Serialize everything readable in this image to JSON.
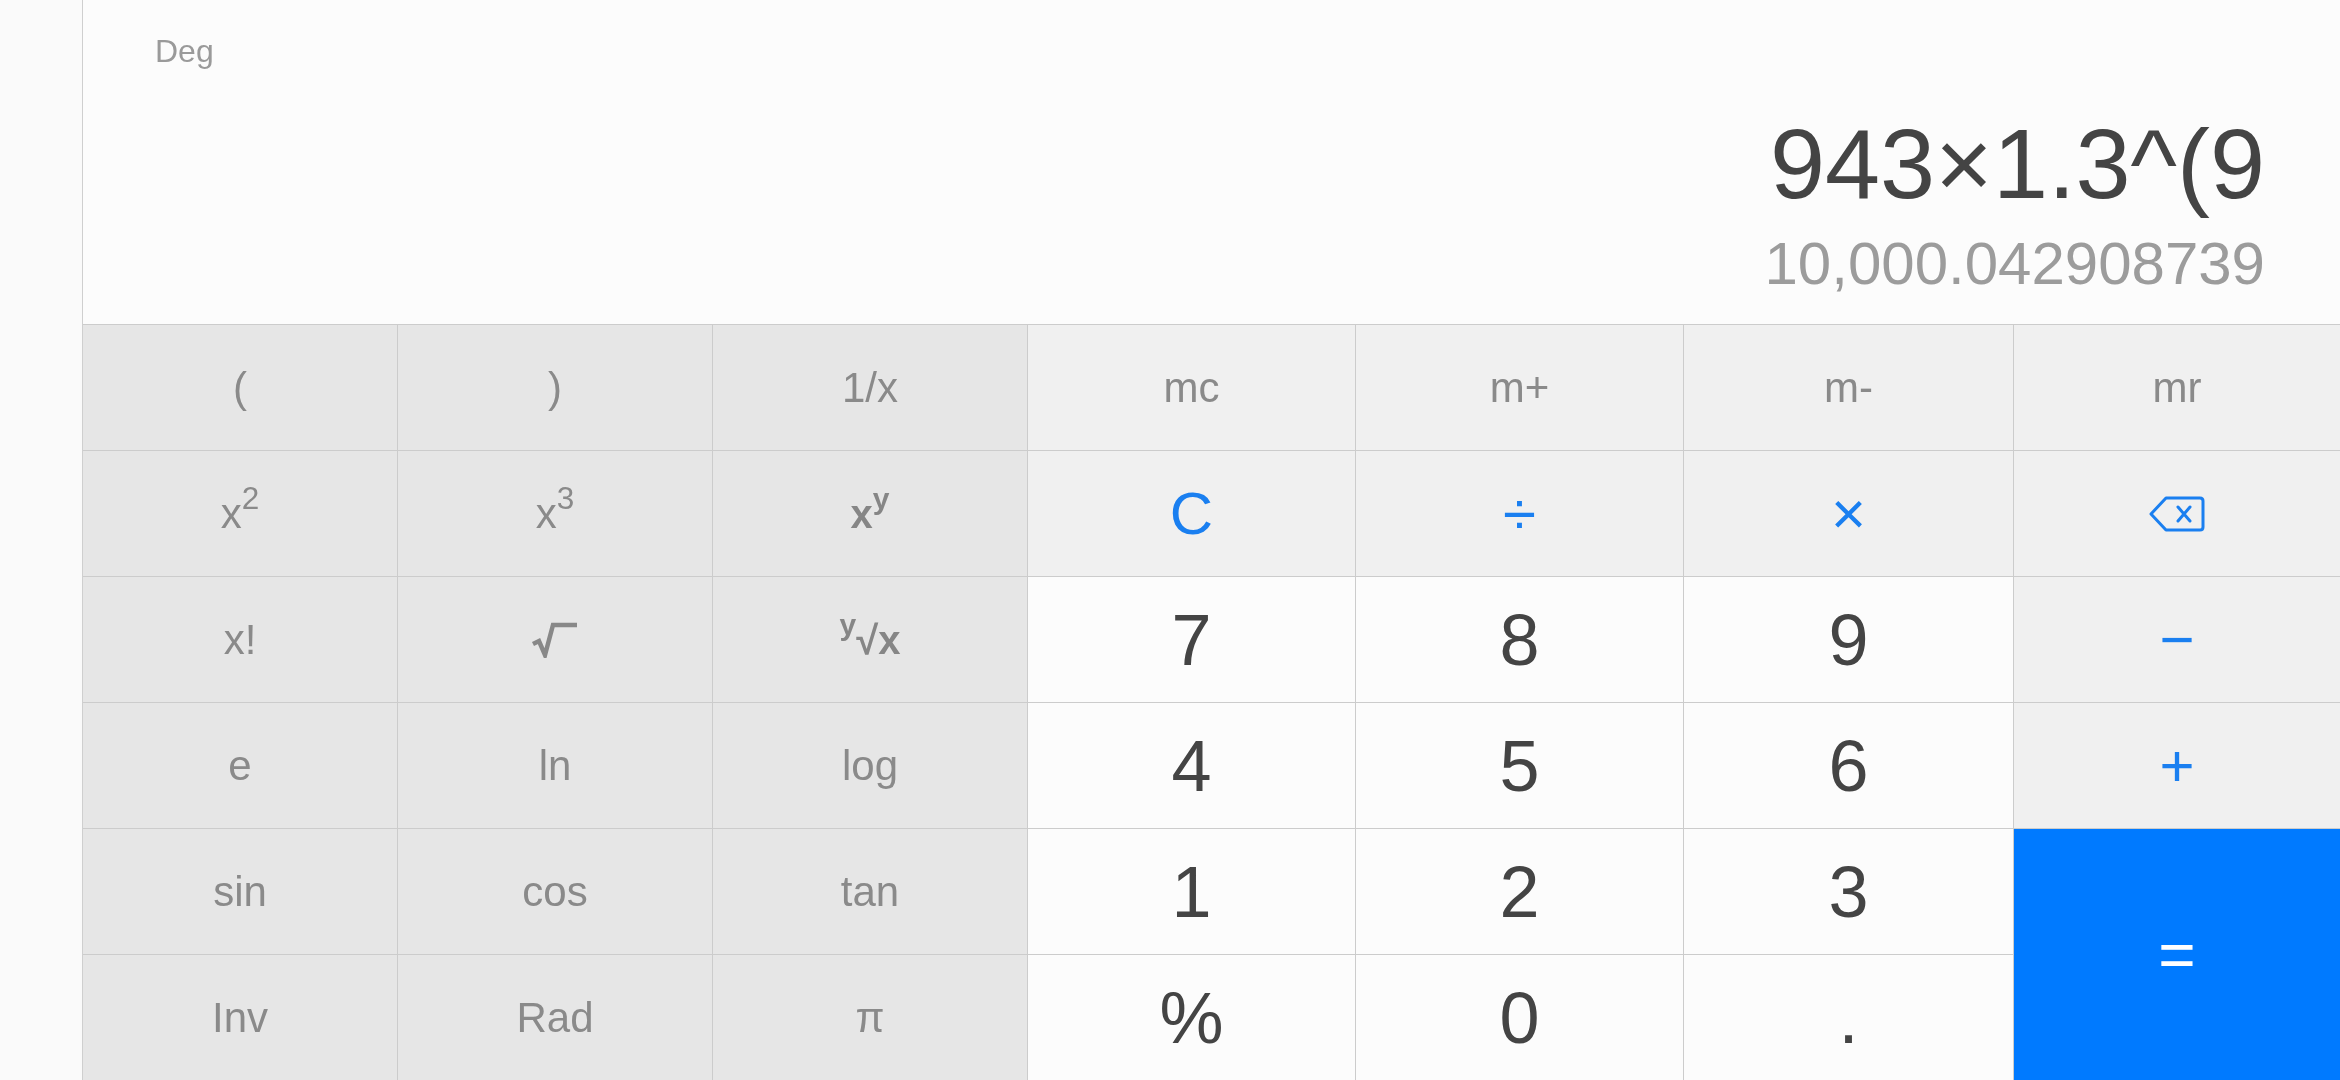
{
  "display": {
    "angle_mode": "Deg",
    "expression": "943×1.3^(9",
    "result": "10,000.042908739"
  },
  "keypad": {
    "rows": [
      [
        {
          "kind": "function",
          "label": "("
        },
        {
          "kind": "function",
          "label": ")"
        },
        {
          "kind": "function",
          "label": "1/x"
        },
        {
          "kind": "memory",
          "label": "mc"
        },
        {
          "kind": "memory",
          "label": "m+"
        },
        {
          "kind": "memory",
          "label": "m-"
        },
        {
          "kind": "memory",
          "label": "mr"
        }
      ],
      [
        {
          "kind": "function",
          "label": "x$^{2}$"
        },
        {
          "kind": "function",
          "label": "x$^{3}$"
        },
        {
          "kind": "emphasized",
          "label": "x$^{y}$"
        },
        {
          "kind": "operator",
          "label": "C"
        },
        {
          "kind": "operator",
          "label": "÷"
        },
        {
          "kind": "operator",
          "label": "×"
        },
        {
          "kind": "backspace"
        }
      ],
      [
        {
          "kind": "function",
          "label": "x!"
        },
        {
          "kind": "root"
        },
        {
          "kind": "emphasized",
          "label": "$^{y}$√x"
        },
        {
          "kind": "digit",
          "label": "7"
        },
        {
          "kind": "digit",
          "label": "8"
        },
        {
          "kind": "digit",
          "label": "9"
        },
        {
          "kind": "operator",
          "label": "−"
        }
      ],
      [
        {
          "kind": "function",
          "label": "e"
        },
        {
          "kind": "function",
          "label": "ln"
        },
        {
          "kind": "function",
          "label": "log"
        },
        {
          "kind": "digit",
          "label": "4"
        },
        {
          "kind": "digit",
          "label": "5"
        },
        {
          "kind": "digit",
          "label": "6"
        },
        {
          "kind": "operator",
          "label": "+"
        }
      ],
      [
        {
          "kind": "function",
          "label": "sin"
        },
        {
          "kind": "function",
          "label": "cos"
        },
        {
          "kind": "function",
          "label": "tan"
        },
        {
          "kind": "digit",
          "label": "1"
        },
        {
          "kind": "digit",
          "label": "2"
        },
        {
          "kind": "digit",
          "label": "3"
        },
        {
          "kind": "equals",
          "label": "="
        }
      ],
      [
        {
          "kind": "function",
          "label": "Inv"
        },
        {
          "kind": "function",
          "label": "Rad"
        },
        {
          "kind": "function",
          "label": "π"
        },
        {
          "kind": "digit",
          "label": "%"
        },
        {
          "kind": "digit",
          "label": "0"
        },
        {
          "kind": "digit",
          "label": "."
        }
      ]
    ]
  }
}
